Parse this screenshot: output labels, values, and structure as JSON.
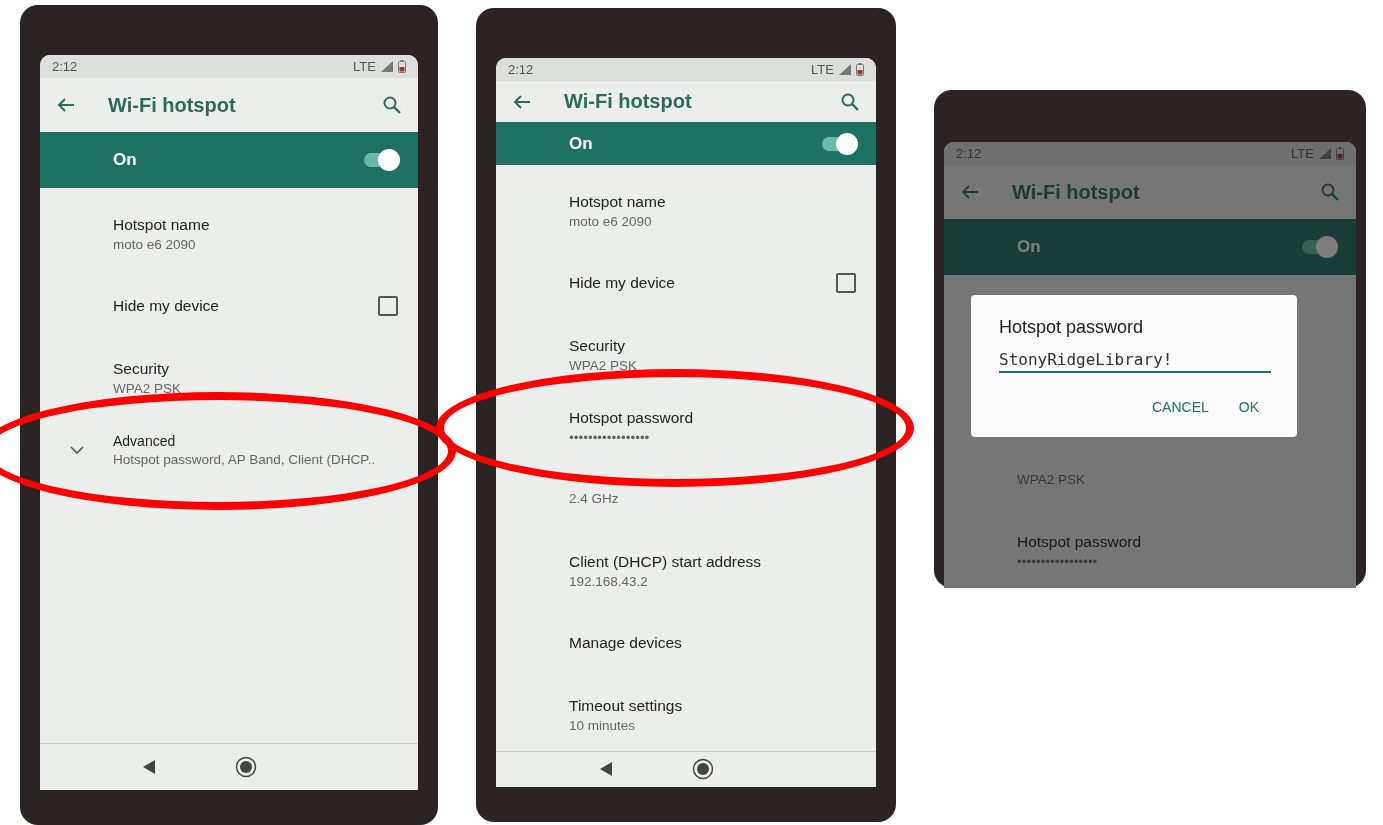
{
  "phones": [
    {
      "status": {
        "time": "2:12",
        "network": "LTE"
      },
      "app_bar": {
        "title": "Wi-Fi hotspot"
      },
      "master_switch": {
        "label": "On",
        "on": true
      },
      "nav_bar": true,
      "items": [
        {
          "kind": "text",
          "title": "Hotspot name",
          "summary": "moto e6 2090",
          "circled": false
        },
        {
          "kind": "checkbox",
          "title": "Hide my device",
          "checked": false,
          "circled": false
        },
        {
          "kind": "text",
          "title": "Security",
          "summary": "WPA2 PSK",
          "circled": false
        },
        {
          "kind": "expand",
          "title": "Advanced",
          "summary": "Hotspot password, AP Band, Client (DHCP..",
          "circled": true
        }
      ]
    },
    {
      "status": {
        "time": "2:12",
        "network": "LTE"
      },
      "app_bar": {
        "title": "Wi-Fi hotspot"
      },
      "master_switch": {
        "label": "On",
        "on": true
      },
      "nav_bar": true,
      "items": [
        {
          "kind": "text",
          "title": "Hotspot name",
          "summary": "moto e6 2090",
          "circled": false
        },
        {
          "kind": "checkbox",
          "title": "Hide my device",
          "checked": false,
          "circled": false
        },
        {
          "kind": "text",
          "title": "Security",
          "summary": "WPA2 PSK",
          "circled": false
        },
        {
          "kind": "text",
          "title": "Hotspot password",
          "summary": "•••••••••••••••••",
          "circled": true
        },
        {
          "kind": "text",
          "summary": "2.4 GHz",
          "circled": false
        },
        {
          "kind": "text",
          "title": "Client (DHCP) start address",
          "summary": "192.168.43.2",
          "circled": false
        },
        {
          "kind": "text",
          "title": "Manage devices",
          "circled": false
        },
        {
          "kind": "text",
          "title": "Timeout settings",
          "summary": "10 minutes",
          "circled": false
        }
      ]
    },
    {
      "status": {
        "time": "2:12",
        "network": "LTE"
      },
      "app_bar": {
        "title": "Wi-Fi hotspot"
      },
      "master_switch": {
        "label": "On",
        "on": true
      },
      "items": [
        {
          "kind": "text",
          "summary": "WPA2 PSK",
          "circled": false
        },
        {
          "kind": "text",
          "title": "Hotspot password",
          "summary": "•••••••••••••••••",
          "circled": false
        }
      ],
      "dialog": {
        "title": "Hotspot password",
        "value": "StonyRidgeLibrary!",
        "buttons": [
          "CANCEL",
          "OK"
        ]
      }
    }
  ]
}
